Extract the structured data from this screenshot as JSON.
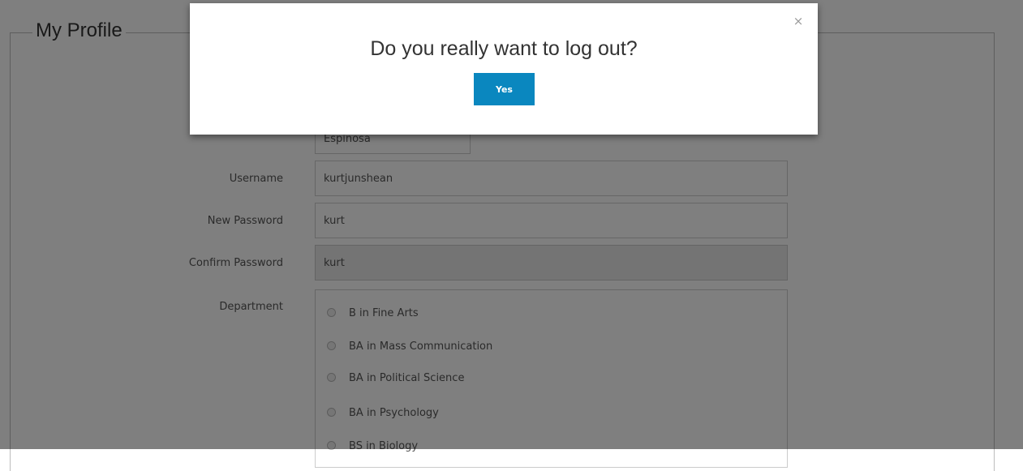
{
  "profile": {
    "legend": "My Profile",
    "last_name_value": "Espinosa",
    "username_label": "Username",
    "username_value": "kurtjunshean",
    "new_password_label": "New Password",
    "new_password_value": "kurt",
    "confirm_password_label": "Confirm Password",
    "confirm_password_value": "kurt",
    "department_label": "Department",
    "departments": [
      "B in Fine Arts",
      "BA in Mass Communication",
      "BA in Political Science",
      "BA in Psychology",
      "BS in Biology"
    ]
  },
  "modal": {
    "title": "Do you really want to log out?",
    "yes_label": "Yes",
    "close_glyph": "×",
    "close_icon": "close-icon"
  },
  "colors": {
    "primary_button": "#0a87bf",
    "overlay": "rgba(0,0,0,0.5)"
  }
}
